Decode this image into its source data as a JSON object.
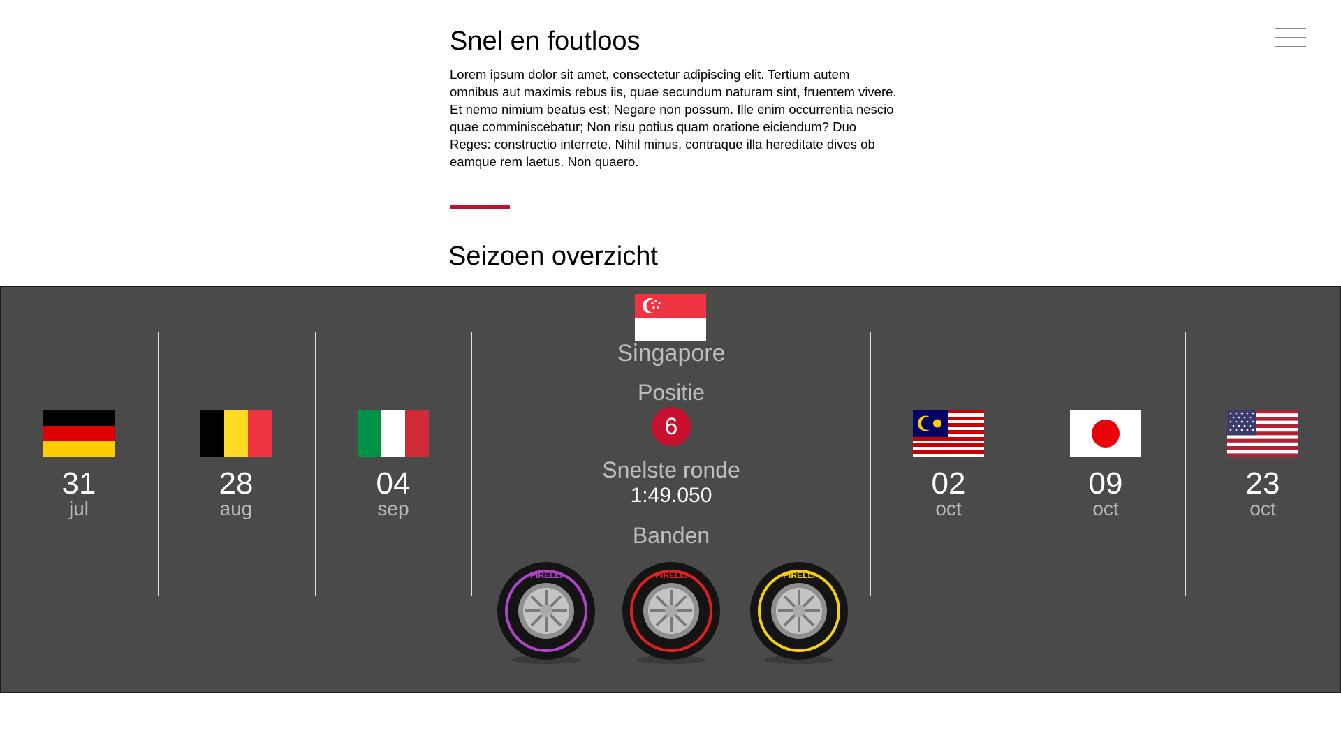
{
  "header": {
    "menu_icon": "hamburger-icon"
  },
  "intro": {
    "title": "Snel en foutloos",
    "body": "Lorem ipsum dolor sit amet, consectetur adipiscing elit. Tertium autem omnibus aut maximis rebus iis, quae secundum naturam sint, fruentem vivere. Et nemo nimium beatus est; Negare non possum. Ille enim occurrentia nescio quae comminiscebatur; Non risu potius quam oratione eiciendum? Duo Reges: constructio interrete. Nihil minus, contraque illa hereditate dives ob eamque rem laetus. Non quaero."
  },
  "season": {
    "title": "Seizoen overzicht",
    "accent_color": "#c8102e",
    "races_before": [
      {
        "flag": "germany-flag",
        "day": "31",
        "month": "jul"
      },
      {
        "flag": "belgium-flag",
        "day": "28",
        "month": "aug"
      },
      {
        "flag": "italy-flag",
        "day": "04",
        "month": "sep"
      }
    ],
    "featured": {
      "flag": "singapore-flag",
      "country": "Singapore",
      "position_label": "Positie",
      "position": "6",
      "fastest_lap_label": "Snelste ronde",
      "fastest_lap": "1:49.050",
      "tyres_label": "Banden",
      "tyres": [
        {
          "icon": "tyre-icon",
          "brand": "PIRELLI",
          "color": "#b044c8"
        },
        {
          "icon": "tyre-icon",
          "brand": "PIRELLI",
          "color": "#e02020"
        },
        {
          "icon": "tyre-icon",
          "brand": "PIRELLI",
          "color": "#f5d10a"
        }
      ]
    },
    "races_after": [
      {
        "flag": "malaysia-flag",
        "day": "02",
        "month": "oct"
      },
      {
        "flag": "japan-flag",
        "day": "09",
        "month": "oct"
      },
      {
        "flag": "usa-flag",
        "day": "23",
        "month": "oct"
      }
    ]
  }
}
